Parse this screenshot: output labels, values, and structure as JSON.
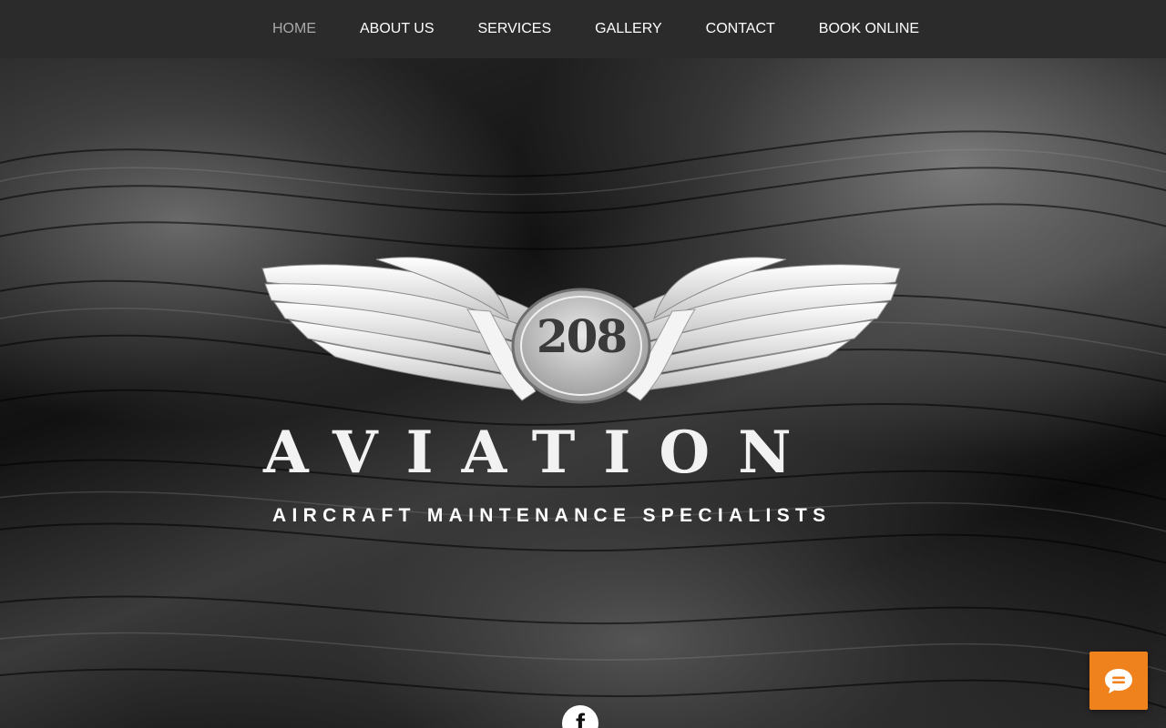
{
  "nav": {
    "items": [
      {
        "label": "HOME",
        "active": true
      },
      {
        "label": "ABOUT US",
        "active": false
      },
      {
        "label": "SERVICES",
        "active": false
      },
      {
        "label": "GALLERY",
        "active": false
      },
      {
        "label": "CONTACT",
        "active": false
      },
      {
        "label": "BOOK ONLINE",
        "active": false
      }
    ]
  },
  "hero": {
    "logo": {
      "badge_number": "208",
      "title": "AVIATION"
    },
    "tagline": "AIRCRAFT MAINTENANCE SPECIALISTS"
  },
  "social": {
    "facebook_glyph": "f"
  },
  "icons": {
    "chat": "chat-bubble-icon",
    "facebook": "facebook-icon"
  },
  "colors": {
    "nav_background": "#2b2b2b",
    "nav_active": "#a9a9a9",
    "chat_button": "#f0821e"
  }
}
